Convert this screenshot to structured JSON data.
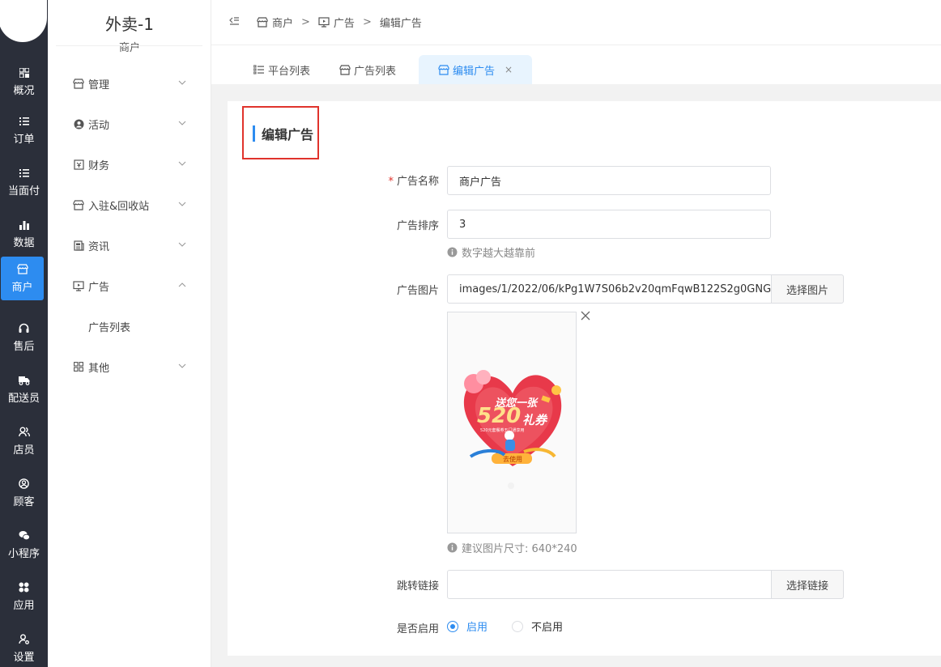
{
  "rail": {
    "items": [
      {
        "label": "概况",
        "icon": "dashboard-grid-icon"
      },
      {
        "label": "订单",
        "icon": "list-icon"
      },
      {
        "label": "当面付",
        "icon": "list-icon"
      },
      {
        "label": "数据",
        "icon": "bar-chart-icon"
      },
      {
        "label": "商户",
        "icon": "store-icon",
        "active": true
      },
      {
        "label": "售后",
        "icon": "headset-icon"
      },
      {
        "label": "配送员",
        "icon": "delivery-truck-icon"
      },
      {
        "label": "店员",
        "icon": "users-icon"
      },
      {
        "label": "顾客",
        "icon": "user-circle-icon"
      },
      {
        "label": "小程序",
        "icon": "wechat-icon"
      },
      {
        "label": "应用",
        "icon": "apps-icon"
      },
      {
        "label": "设置",
        "icon": "settings-user-icon"
      }
    ]
  },
  "sidebar": {
    "title": "外卖-1",
    "subtitle": "商户",
    "menu": [
      {
        "label": "管理",
        "icon": "store-icon",
        "expanded": false
      },
      {
        "label": "活动",
        "icon": "user-circle-icon",
        "expanded": false
      },
      {
        "label": "财务",
        "icon": "finance-icon",
        "expanded": false
      },
      {
        "label": "入驻&回收站",
        "icon": "store-icon",
        "expanded": false
      },
      {
        "label": "资讯",
        "icon": "news-icon",
        "expanded": false
      },
      {
        "label": "广告",
        "icon": "monitor-icon",
        "expanded": true
      },
      {
        "label": "广告列表",
        "sub": true
      },
      {
        "label": "其他",
        "icon": "grid-icon",
        "expanded": false
      }
    ]
  },
  "header": {
    "breadcrumbs": [
      {
        "label": "商户",
        "icon": "store-icon"
      },
      {
        "label": "广告",
        "icon": "monitor-icon"
      },
      {
        "label": "编辑广告"
      }
    ],
    "separator": ">"
  },
  "tabs": [
    {
      "label": "平台列表",
      "icon": "list-icon"
    },
    {
      "label": "广告列表",
      "icon": "store-icon"
    },
    {
      "label": "编辑广告",
      "icon": "store-icon",
      "active": true,
      "close": "×"
    }
  ],
  "form": {
    "title": "编辑广告",
    "name": {
      "label": "广告名称",
      "required": "*",
      "value": "商户广告"
    },
    "order": {
      "label": "广告排序",
      "value": "3",
      "hint": "数字越大越靠前"
    },
    "image": {
      "label": "广告图片",
      "value": "images/1/2022/06/kPg1W7S06b2v20qmFqwB122S2g0GNG",
      "button": "选择图片",
      "hint": "建议图片尺寸: 640*240",
      "banner_top": "送您一张",
      "banner_big": "520",
      "banner_coupon": "礼券",
      "banner_small": "520元套餐券五门通享用",
      "banner_btn": "去使用"
    },
    "link": {
      "label": "跳转链接",
      "value": "",
      "button": "选择链接"
    },
    "enabled": {
      "label": "是否启用",
      "options": [
        "启用",
        "不启用"
      ],
      "selected": 0
    }
  },
  "colors": {
    "accent": "#2d8cf0",
    "rail_bg": "#2b2f3a",
    "highlight_box": "#e0332c"
  }
}
